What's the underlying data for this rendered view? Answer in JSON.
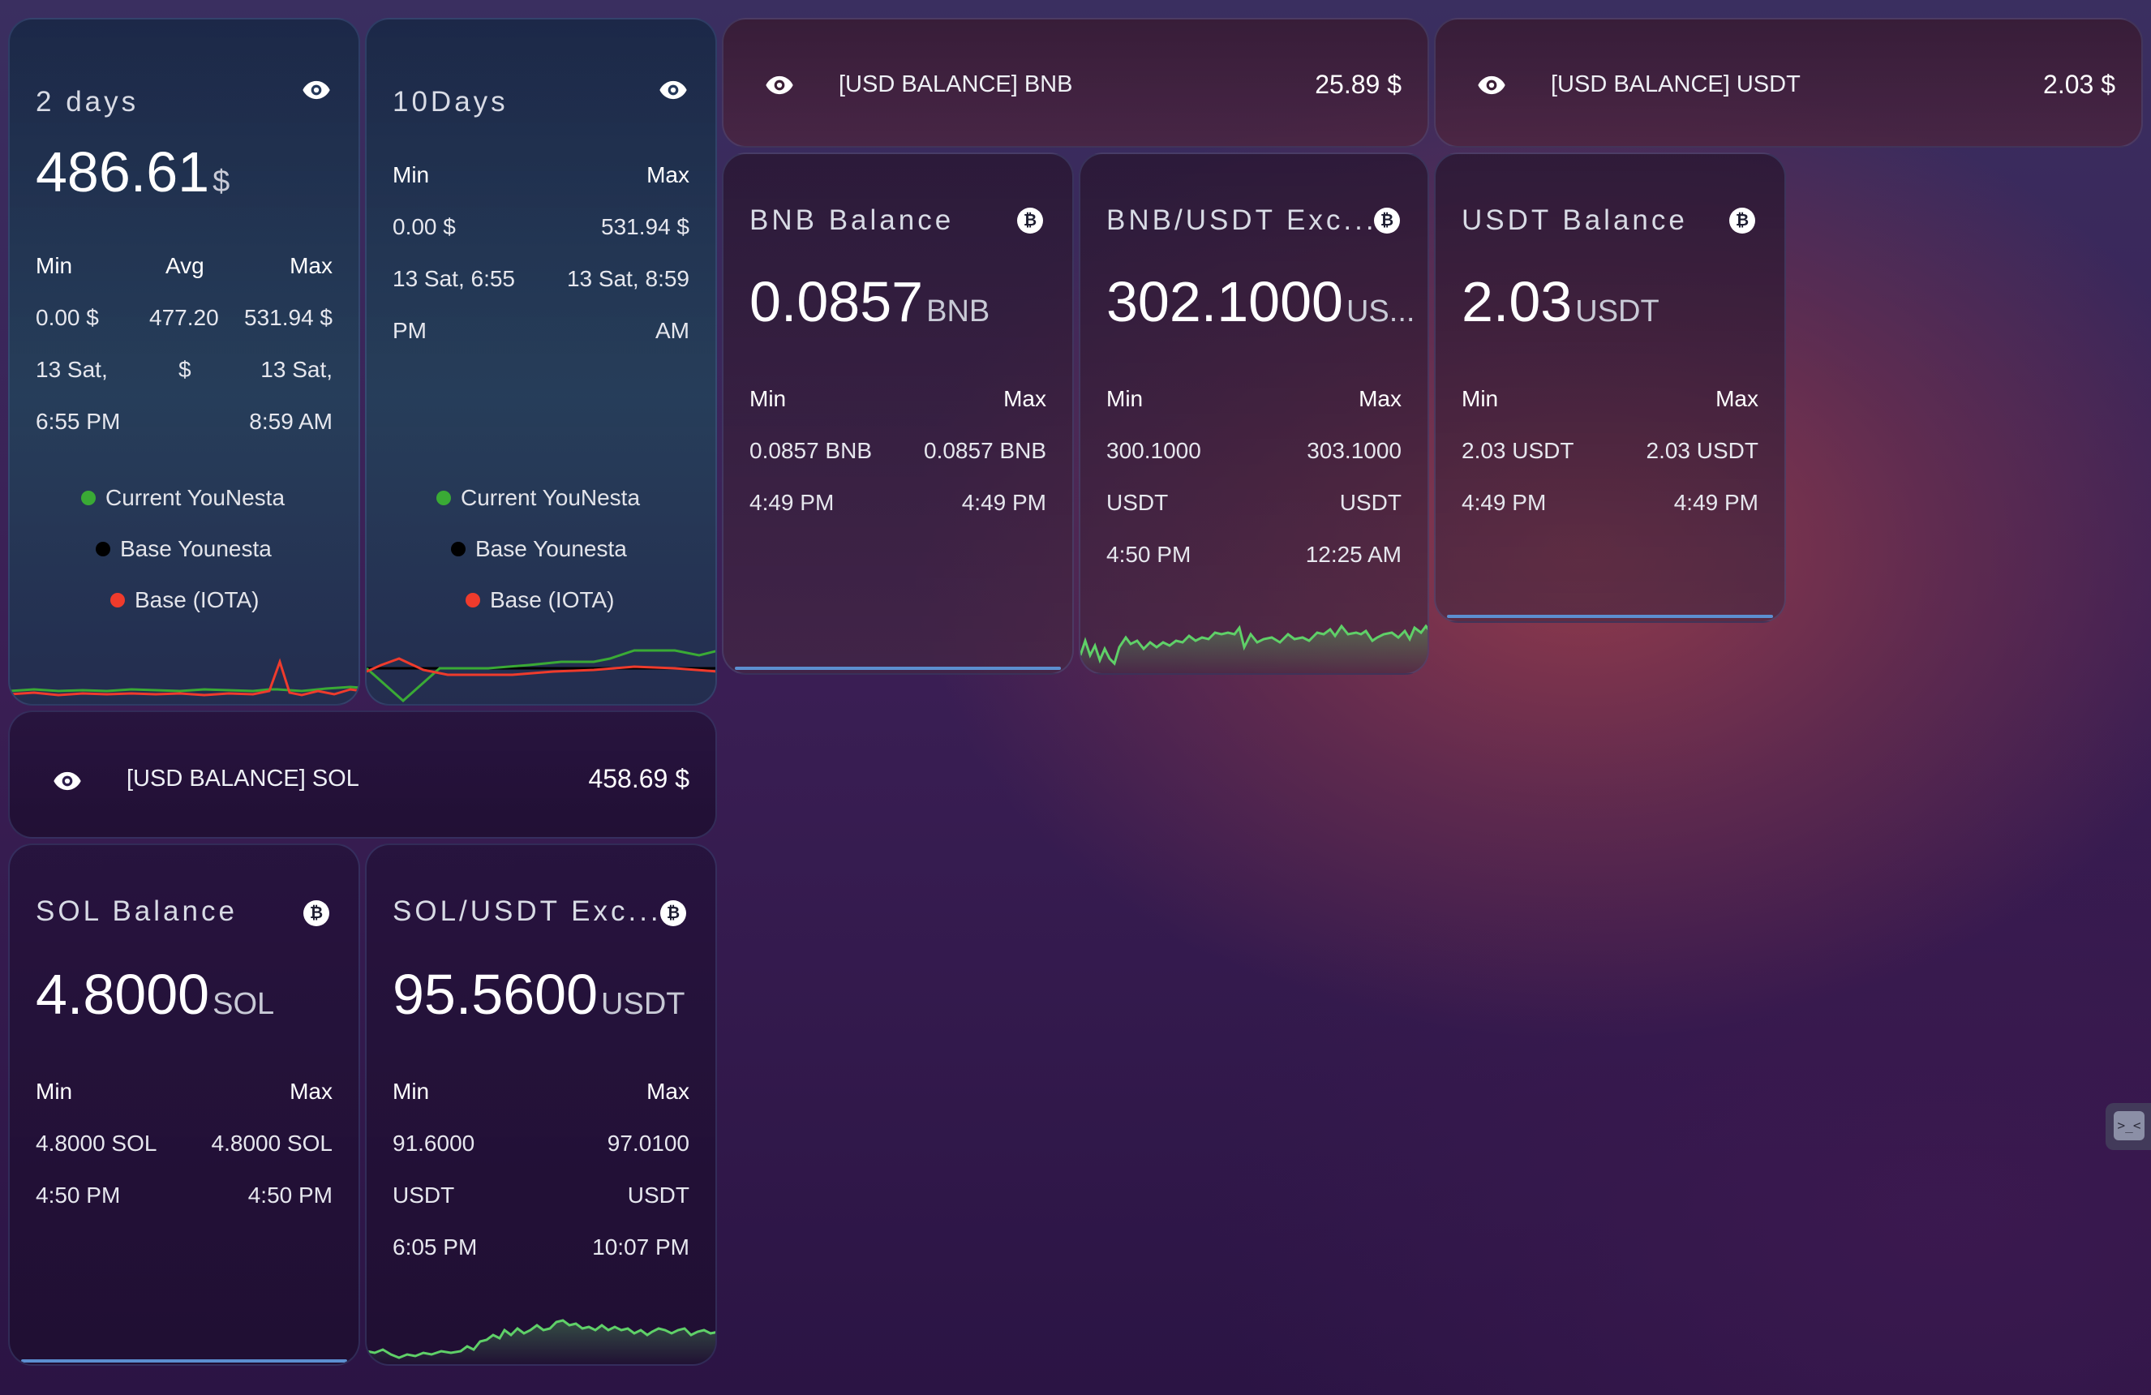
{
  "colors": {
    "current": "#3aaa35",
    "base_younesta": "#000000",
    "base_iota": "#ef3b2c",
    "spark_green": "#5fd068",
    "bar_blue": "#5c8fd0"
  },
  "icons": {
    "visibility": "eye-icon",
    "bitcoin": "bitcoin-icon",
    "terminal": "terminal-icon"
  },
  "btc_glyph": "₿",
  "card_2days": {
    "title": "2 days",
    "value": "486.61",
    "unit": "$",
    "labels": {
      "min": "Min",
      "avg": "Avg",
      "max": "Max"
    },
    "min_value": "0.00 $",
    "avg_value": "477.20",
    "avg_unit": "$",
    "max_value": "531.94 $",
    "min_time_1": "13 Sat,",
    "min_time_2": "6:55 PM",
    "max_time_1": "13 Sat,",
    "max_time_2": "8:59 AM",
    "legend": [
      "Current YouNesta",
      "Base Younesta",
      "Base (IOTA)"
    ]
  },
  "card_10days": {
    "title": "10Days",
    "labels": {
      "min": "Min",
      "max": "Max"
    },
    "min_value": "0.00 $",
    "max_value": "531.94 $",
    "min_time_1": "13 Sat, 6:55",
    "min_time_2": "PM",
    "max_time_1": "13 Sat, 8:59",
    "max_time_2": "AM",
    "legend": [
      "Current YouNesta",
      "Base Younesta",
      "Base (IOTA)"
    ]
  },
  "banner_bnb": {
    "label": "[USD BALANCE] BNB",
    "value": "25.89 $"
  },
  "banner_usdt": {
    "label": "[USD BALANCE] USDT",
    "value": "2.03 $"
  },
  "banner_sol": {
    "label": "[USD BALANCE] SOL",
    "value": "458.69 $"
  },
  "bnb_balance": {
    "title": "BNB Balance",
    "value": "0.0857",
    "unit": "BNB",
    "labels": {
      "min": "Min",
      "max": "Max"
    },
    "min_value": "0.0857 BNB",
    "max_value": "0.0857 BNB",
    "min_time": "4:49 PM",
    "max_time": "4:49 PM"
  },
  "bnb_usdt": {
    "title": "BNB/USDT Exc...",
    "value": "302.1000",
    "unit": "US...",
    "labels": {
      "min": "Min",
      "max": "Max"
    },
    "min_value": "300.1000",
    "max_value": "303.1000",
    "min_unit": "USDT",
    "max_unit": "USDT",
    "min_time": "4:50 PM",
    "max_time": "12:25 AM"
  },
  "usdt_balance": {
    "title": "USDT Balance",
    "value": "2.03",
    "unit": "USDT",
    "labels": {
      "min": "Min",
      "max": "Max"
    },
    "min_value": "2.03 USDT",
    "max_value": "2.03 USDT",
    "min_time": "4:49 PM",
    "max_time": "4:49 PM"
  },
  "sol_balance": {
    "title": "SOL Balance",
    "value": "4.8000",
    "unit": "SOL",
    "labels": {
      "min": "Min",
      "max": "Max"
    },
    "min_value": "4.8000 SOL",
    "max_value": "4.8000 SOL",
    "min_time": "4:50 PM",
    "max_time": "4:50 PM"
  },
  "sol_usdt": {
    "title": "SOL/USDT Exc...",
    "value": "95.5600",
    "unit": "USDT",
    "labels": {
      "min": "Min",
      "max": "Max"
    },
    "min_value": "91.6000",
    "max_value": "97.0100",
    "min_unit": "USDT",
    "max_unit": "USDT",
    "min_time": "6:05 PM",
    "max_time": "10:07 PM"
  }
}
